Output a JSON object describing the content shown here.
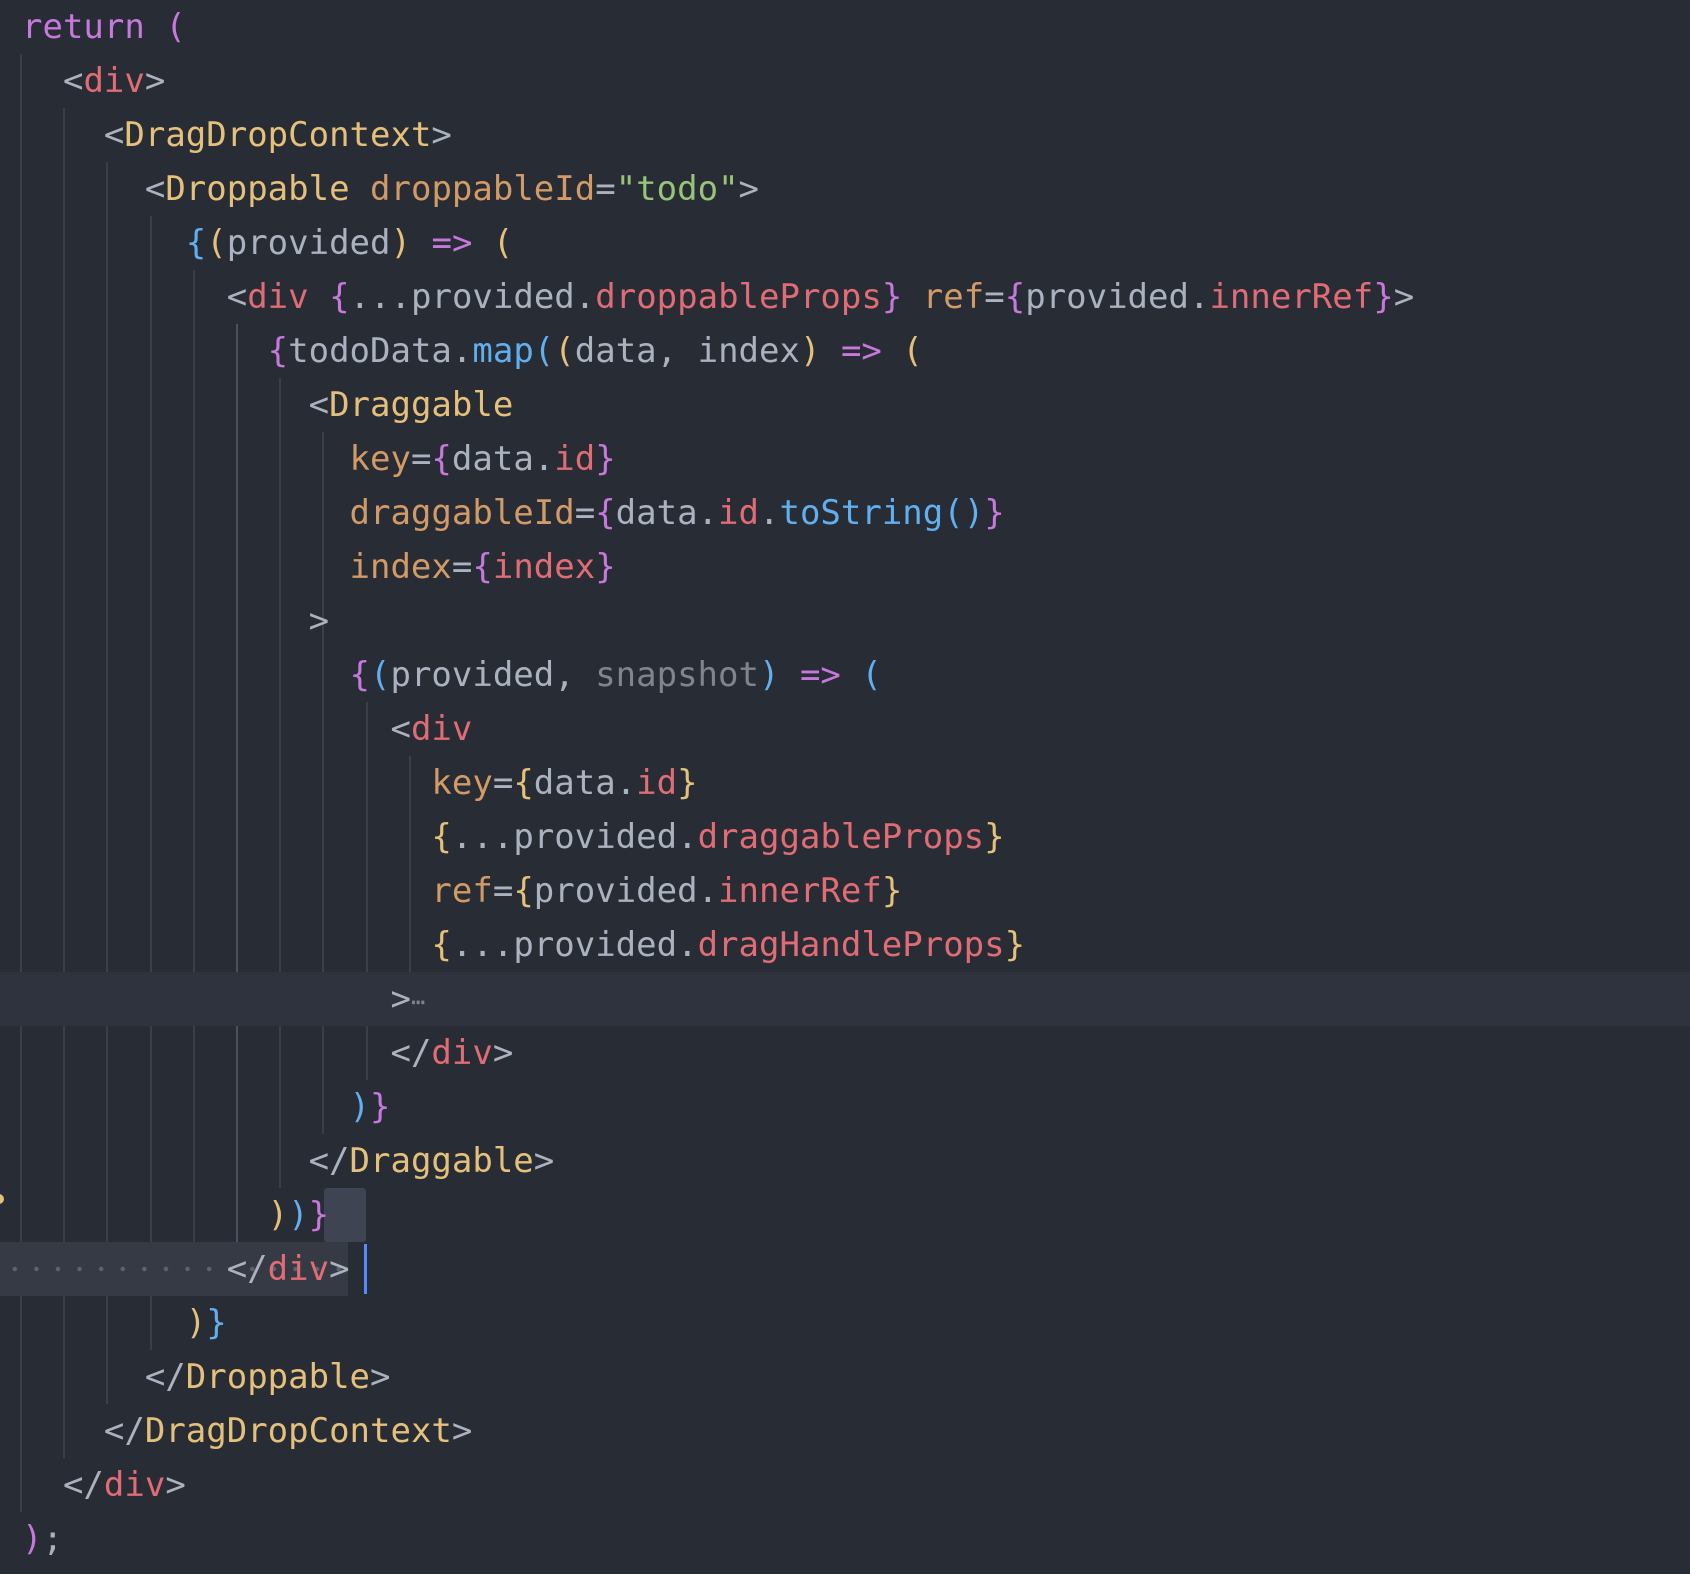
{
  "editor": {
    "theme": "one-dark",
    "colors": {
      "background": "#282c34",
      "keyword": "#c678dd",
      "tag": "#e06c75",
      "component": "#e5c07b",
      "attribute": "#d19a66",
      "string": "#98c379",
      "function": "#61afef",
      "plain": "#abb2bf",
      "cursor": "#528bff"
    },
    "fold_marker": "⋯"
  },
  "code_lines": [
    "return (",
    "  <div>",
    "    <DragDropContext>",
    "      <Droppable droppableId=\"todo\">",
    "        {(provided) => (",
    "          <div {...provided.droppableProps} ref={provided.innerRef}>",
    "            {todoData.map((data, index) => (",
    "              <Draggable",
    "                key={data.id}",
    "                draggableId={data.id.toString()}",
    "                index={index}",
    "              >",
    "                {(provided, snapshot) => (",
    "                  <div",
    "                    key={data.id}",
    "                    {...provided.draggableProps}",
    "                    ref={provided.innerRef}",
    "                    {...provided.dragHandleProps}",
    "                  >⋯",
    "                  </div>",
    "                )}",
    "              </Draggable>",
    "            ))}",
    "          </div>",
    "        )}",
    "      </Droppable>",
    "    </DragDropContext>",
    "  </div>",
    ");"
  ],
  "tokens": {
    "kw_return": "return",
    "p_open": "(",
    "lt": "<",
    "gt": ">",
    "lt_slash": "</",
    "div": "div",
    "DragDropContext": "DragDropContext",
    "Droppable": "Droppable",
    "Draggable": "Draggable",
    "droppableId": "droppableId",
    "eq": "=",
    "q": "\"",
    "todo": "todo",
    "brace_open": "{",
    "brace_close": "}",
    "paren_open": "(",
    "paren_close": ")",
    "arrow": "=>",
    "provided": "provided",
    "spread": "...",
    "dot": ".",
    "droppableProps": "droppableProps",
    "ref": "ref",
    "innerRef": "innerRef",
    "todoData": "todoData",
    "map": "map",
    "data": "data",
    "comma": ", ",
    "index": "index",
    "key": "key",
    "id": "id",
    "draggableId": "draggableId",
    "toString": "toString",
    "snapshot": "snapshot",
    "draggableProps": "draggableProps",
    "dragHandleProps": "dragHandleProps",
    "semi": ";"
  }
}
